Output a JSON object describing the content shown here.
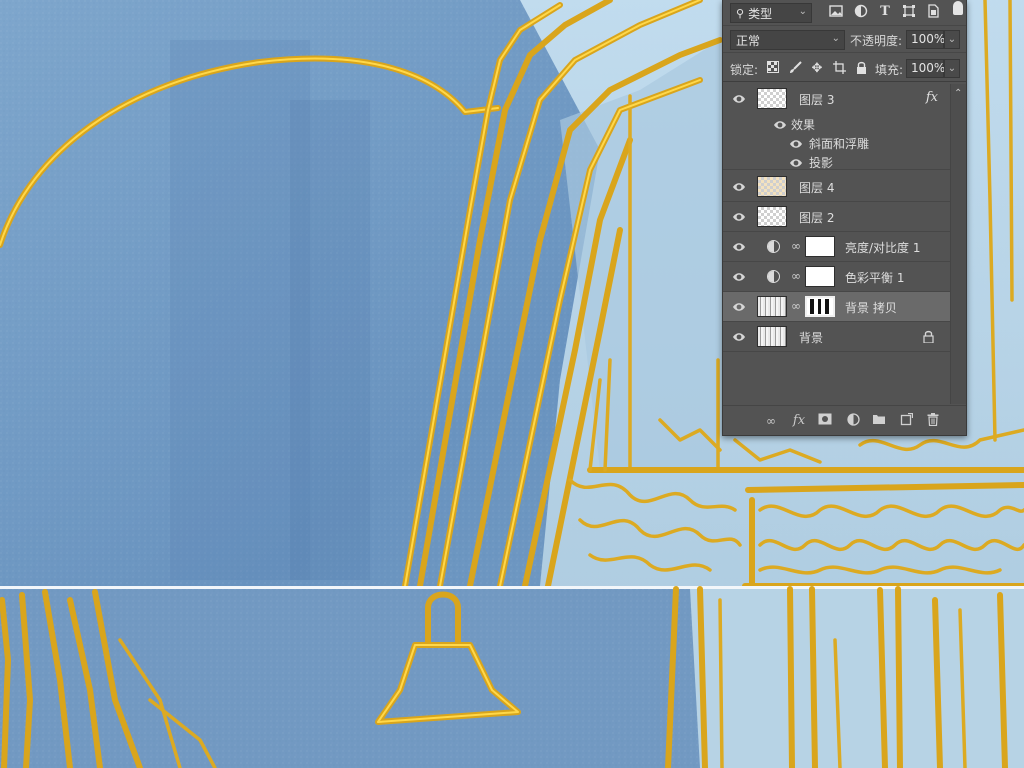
{
  "panel": {
    "filter_type_label": "类型",
    "blend_mode": "正常",
    "opacity_label": "不透明度:",
    "opacity_value": "100%",
    "lock_label": "锁定:",
    "fill_label": "填充:",
    "fill_value": "100%",
    "filter_icons": [
      "image-filter-icon",
      "adjustment-filter-icon",
      "type-filter-icon",
      "shape-filter-icon",
      "smart-object-filter-icon"
    ],
    "lock_icons": [
      "lock-transparent-icon",
      "lock-image-icon",
      "lock-position-icon",
      "lock-artboard-icon",
      "lock-all-icon"
    ],
    "footer_icons": [
      "link-layers-icon",
      "add-layer-style-icon",
      "add-mask-icon",
      "new-adjustment-icon",
      "new-group-icon",
      "new-layer-icon",
      "delete-layer-icon"
    ]
  },
  "layers": [
    {
      "name": "图层 3",
      "has_fx": true,
      "fx_label": "fx",
      "effects_label": "效果",
      "effects": [
        "斜面和浮雕",
        "投影"
      ]
    },
    {
      "name": "图层 4"
    },
    {
      "name": "图层 2"
    },
    {
      "name": "亮度/对比度 1",
      "type": "adjustment"
    },
    {
      "name": "色彩平衡 1",
      "type": "adjustment"
    },
    {
      "name": "背景 拷贝",
      "selected": true
    },
    {
      "name": "背景",
      "locked": true
    }
  ],
  "colors": {
    "canvas_blue": "#6f98c2",
    "pale_blue": "#b9d6e6",
    "gold": "#d9a51c",
    "panel_bg": "#535353",
    "selected_row": "#6a6a6a"
  }
}
